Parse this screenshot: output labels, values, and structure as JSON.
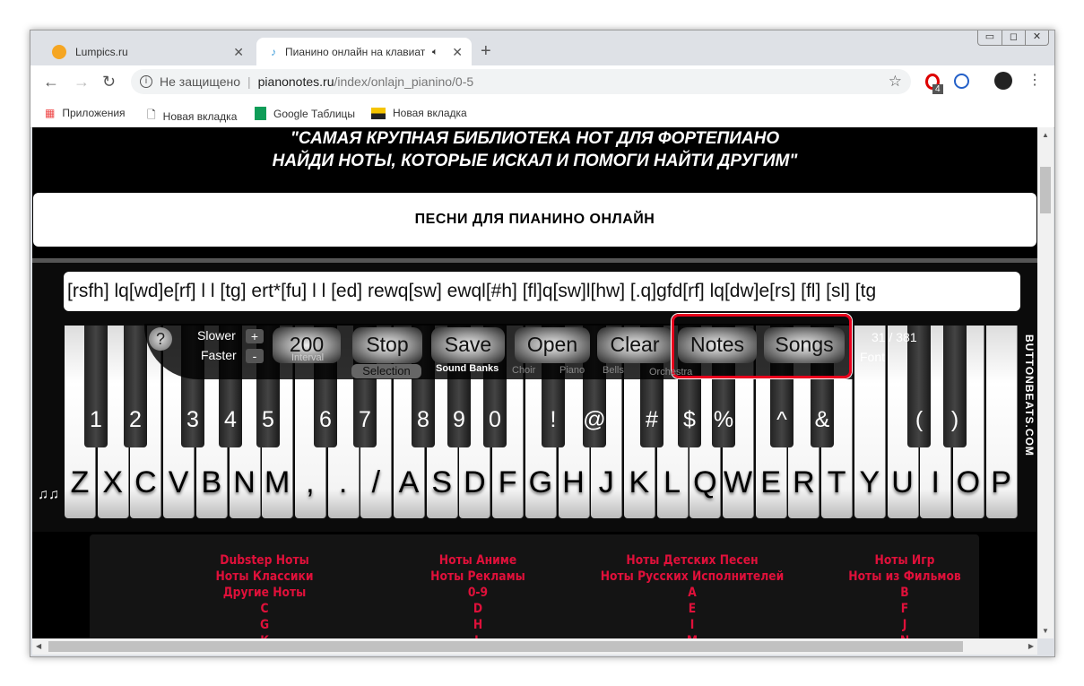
{
  "browser": {
    "tabs": [
      {
        "title": "Lumpics.ru",
        "icon": "orange-icon"
      },
      {
        "title": "Пианино онлайн на клавиат",
        "icon": "music-note-icon",
        "audio": true
      }
    ],
    "url": {
      "security": "Не защищено",
      "host": "pianonotes.ru",
      "path": "/index/onlajn_pianino/0-5"
    },
    "extension_badge": "4",
    "bookmarks": [
      "Приложения",
      "Новая вкладка",
      "Google Таблицы",
      "Новая вкладка"
    ]
  },
  "page": {
    "banner": [
      "\"САМАЯ КРУПНАЯ БИБЛИОТЕКА НОТ ДЛЯ ФОРТЕПИАНО",
      "НАЙДИ НОТЫ, КОТОРЫЕ ИСКАЛ И ПОМОГИ НАЙТИ ДРУГИМ\""
    ],
    "section_title": "ПЕСНИ ДЛЯ ПИАНИНО ОНЛАЙН",
    "notes_text": "[rsfh] lq[wd]e[rf] l l [tg] ert*[fu] l l [ed] rewq[sw] ewql[#h] [fl]q[sw]l[hw] [.q]gfd[rf] lq[dw]e[rs] [fl] [sl] [tg",
    "controls": {
      "help": "?",
      "slower": "Slower",
      "faster": "Faster",
      "plus": "+",
      "minus": "-",
      "interval_value": "200",
      "interval_label": "Interval",
      "stop": "Stop",
      "selection": "Selection",
      "save": "Save",
      "open": "Open",
      "clear": "Clear",
      "notes": "Notes",
      "songs": "Songs",
      "counter": "31 / 381",
      "font": "Font",
      "sound_banks": "Sound Banks",
      "banks": [
        "Choir",
        "Piano",
        "Bells",
        "Orchestra"
      ]
    },
    "white_keys": [
      "Z",
      "X",
      "C",
      "V",
      "B",
      "N",
      "M",
      ",",
      ".",
      "/",
      "A",
      "S",
      "D",
      "F",
      "G",
      "H",
      "J",
      "K",
      "L",
      "Q",
      "W",
      "E",
      "R",
      "T",
      "Y",
      "U",
      "I",
      "O",
      "P"
    ],
    "black_keys": [
      "1",
      "2",
      "3",
      "4",
      "5",
      "6",
      "7",
      "8",
      "9",
      "0",
      "!",
      "@",
      "#",
      "$",
      "%",
      "^",
      "&",
      "(",
      ")"
    ],
    "brand": "BUTTONBEATS.COM",
    "link_columns": [
      [
        "Dubstep Ноты",
        "Ноты Классики",
        "Другие Ноты",
        "C",
        "G",
        "K"
      ],
      [
        "Ноты Аниме",
        "Ноты Рекламы",
        "0-9",
        "D",
        "H",
        "L"
      ],
      [
        "Ноты Детских Песен",
        "Ноты Русских Исполнителей",
        "A",
        "E",
        "I",
        "M"
      ],
      [
        "Ноты Игр",
        "Ноты из Фильмов",
        "B",
        "F",
        "J",
        "N"
      ]
    ],
    "link_color": "#e0103a",
    "highlight_color": "#e8001c"
  }
}
